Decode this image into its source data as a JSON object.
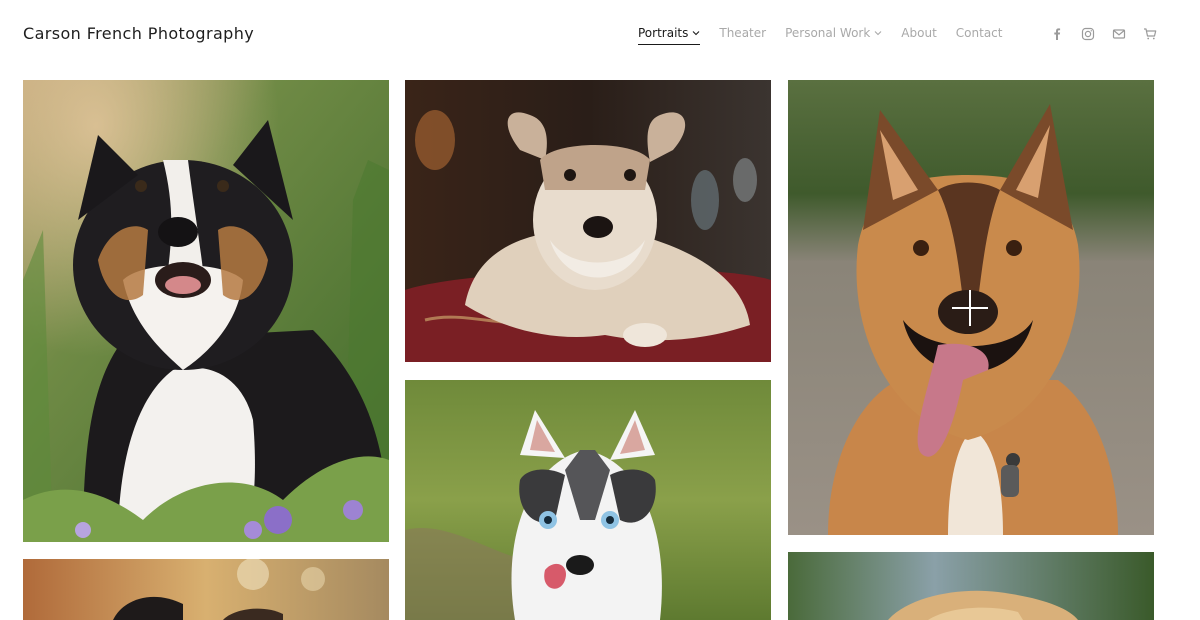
{
  "site": {
    "title": "Carson French Photography"
  },
  "nav": {
    "items": [
      {
        "label": "Portraits",
        "has_dropdown": true,
        "active": true
      },
      {
        "label": "Theater",
        "has_dropdown": false,
        "active": false
      },
      {
        "label": "Personal Work",
        "has_dropdown": true,
        "active": false
      },
      {
        "label": "About",
        "has_dropdown": false,
        "active": false
      },
      {
        "label": "Contact",
        "has_dropdown": false,
        "active": false
      }
    ]
  },
  "social": [
    "facebook-icon",
    "instagram-icon",
    "email-icon",
    "cart-icon"
  ],
  "gallery": {
    "photos": [
      {
        "subject": "Australian shepherd among flowers"
      },
      {
        "subject": "Schnauzer lying on red cushion"
      },
      {
        "subject": "German shepherd mix with tongue out"
      },
      {
        "subject": "Husky puppy licking nose"
      },
      {
        "subject": "Dog portrait, partially visible"
      },
      {
        "subject": "Golden dog portrait, partially visible"
      }
    ]
  },
  "colors": {
    "nav_active": "#1a1a1a",
    "nav_inactive": "#a9a9a9",
    "background": "#ffffff"
  }
}
